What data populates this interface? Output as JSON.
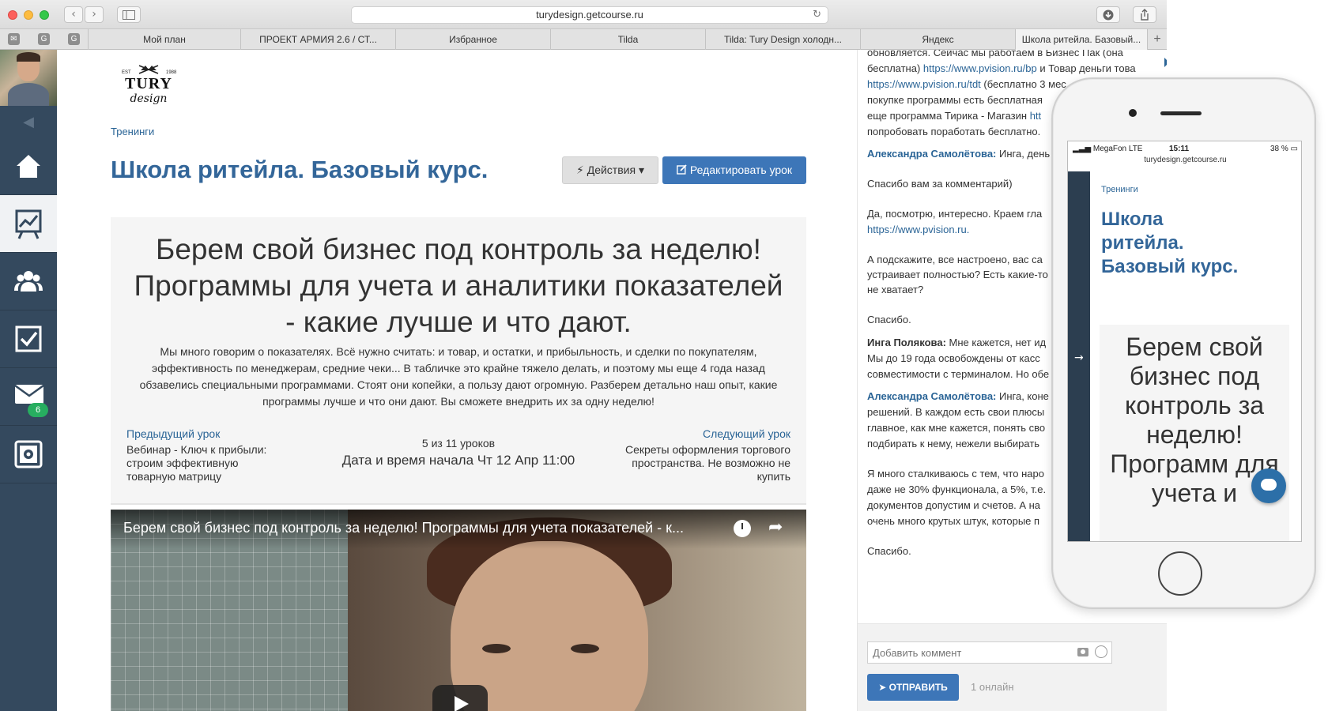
{
  "browser": {
    "url": "turydesign.getcourse.ru",
    "reload_glyph": "↻",
    "bookmarks": [
      {
        "label": "Мой план"
      },
      {
        "label": "ПРОЕКТ АРМИЯ 2.6 / СТ..."
      },
      {
        "label": "Избранное"
      },
      {
        "label": "Tilda"
      },
      {
        "label": "Tilda: Tury Design холодн..."
      },
      {
        "label": "Яндекс"
      },
      {
        "label": "Школа ритейла. Базовый..."
      }
    ],
    "plus": "+"
  },
  "sidebar": {
    "mail_badge": "6",
    "colors": {
      "bg": "#34495e",
      "active": "#f0f2f4",
      "badge": "#27ae60"
    }
  },
  "main": {
    "logo": {
      "top": "EST",
      "year": "1988",
      "brand": "TURY",
      "script": "design"
    },
    "breadcrumb": "Тренинги",
    "title": "Школа ритейла. Базовый курс.",
    "actions_label": "⚡ Действия ▾",
    "edit_label": "Редактировать урок",
    "lesson": {
      "heading": "Берем свой бизнес под контроль за неделю! Программы для учета и аналитики показателей - какие лучше и что дают.",
      "description": "Мы много говорим о показателях. Всё нужно считать: и товар, и остатки, и прибыльность, и сделки по покупателям, эффективность по менеджерам, средние чеки... В табличке это крайне тяжело делать, и поэтому мы еще 4 года назад обзавелись специальными программами. Стоят они копейки, а пользу дают огромную. Разберем детально наш опыт, какие программы лучше и что они дают. Вы сможете внедрить их за одну неделю!",
      "prev_link": "Предыдущий урок",
      "prev_title": "Вебинар - Ключ к прибыли: строим эффективную товарную матрицу",
      "counter": "5 из 11 уроков",
      "start_date": "Дата и время начала Чт 12 Апр 11:00",
      "next_link": "Следующий урок",
      "next_title": "Секреты оформления торгового пространства. Не возможно не купить"
    },
    "video": {
      "title": "Берем свой бизнес под контроль за неделю! Программы для учета показателей - к..."
    },
    "colors": {
      "title": "#336699",
      "link": "#2a6496",
      "button": "#3d76b8"
    }
  },
  "comments": {
    "lines": {
      "l1": "обновляется. Сейчас мы работаем в Бизнес Пак (она",
      "l2a": "бесплатна) ",
      "l2link": "https://www.pvision.ru/bp",
      "l2b": " и Товар деньги това",
      "l3link": "https://www.pvision.ru/tdt",
      "l3b": " (бесплатно 3 мес",
      "l4": "покупке программы есть бесплатная",
      "l5a": "еще программа Тирика - Магазин ",
      "l5link": "htt",
      "l6": "попробовать поработать бесплатно.",
      "a1_author": "Александра Самолётова:",
      "a1_text": " Инга, день",
      "l8": "Спасибо вам за комментарий)",
      "l9": "Да, посмотрю, интересно. Краем гла",
      "l10link": "https://www.pvision.ru.",
      "l11": "А подскажите, все настроено, вас са",
      "l12": "устраивает полностью? Есть какие-то",
      "l13": "не хватает?",
      "l14": "Спасибо.",
      "b1_author": "Инга Полякова:",
      "b1_text": " Мне кажется, нет ид",
      "l16": "Мы до 19 года освобождены от касс",
      "l17": "совместимости с терминалом. Но обе",
      "a2_author": "Александра Самолётова:",
      "a2_text": " Инга, коне",
      "l19": "решений. В каждом есть свои плюсы",
      "l20": "главное, как мне кажется, понять сво",
      "l21": "подбирать к нему, нежели выбирать",
      "l22": "Я много сталкиваюсь с тем, что наро",
      "l23": "даже не 30% функционала, а 5%, т.е.",
      "l24": "документов допустим и счетов. А на",
      "l25": "очень много крутых штук, которые п",
      "l26": "Спасибо."
    },
    "input_placeholder": "Добавить коммент",
    "send_label": "ОТПРАВИТЬ",
    "send_glyph": "➤",
    "online": "1 онлайн"
  },
  "phone": {
    "carrier": "MegaFon  LTE",
    "time": "15:11",
    "battery": "38 %",
    "url": "turydesign.getcourse.ru",
    "breadcrumb": "Тренинги",
    "title": "Школа ритейла. Базовый курс.",
    "lesson_heading": "Берем свой бизнес под контроль за неделю! Программ для учета и",
    "arrow_glyph": "→"
  }
}
